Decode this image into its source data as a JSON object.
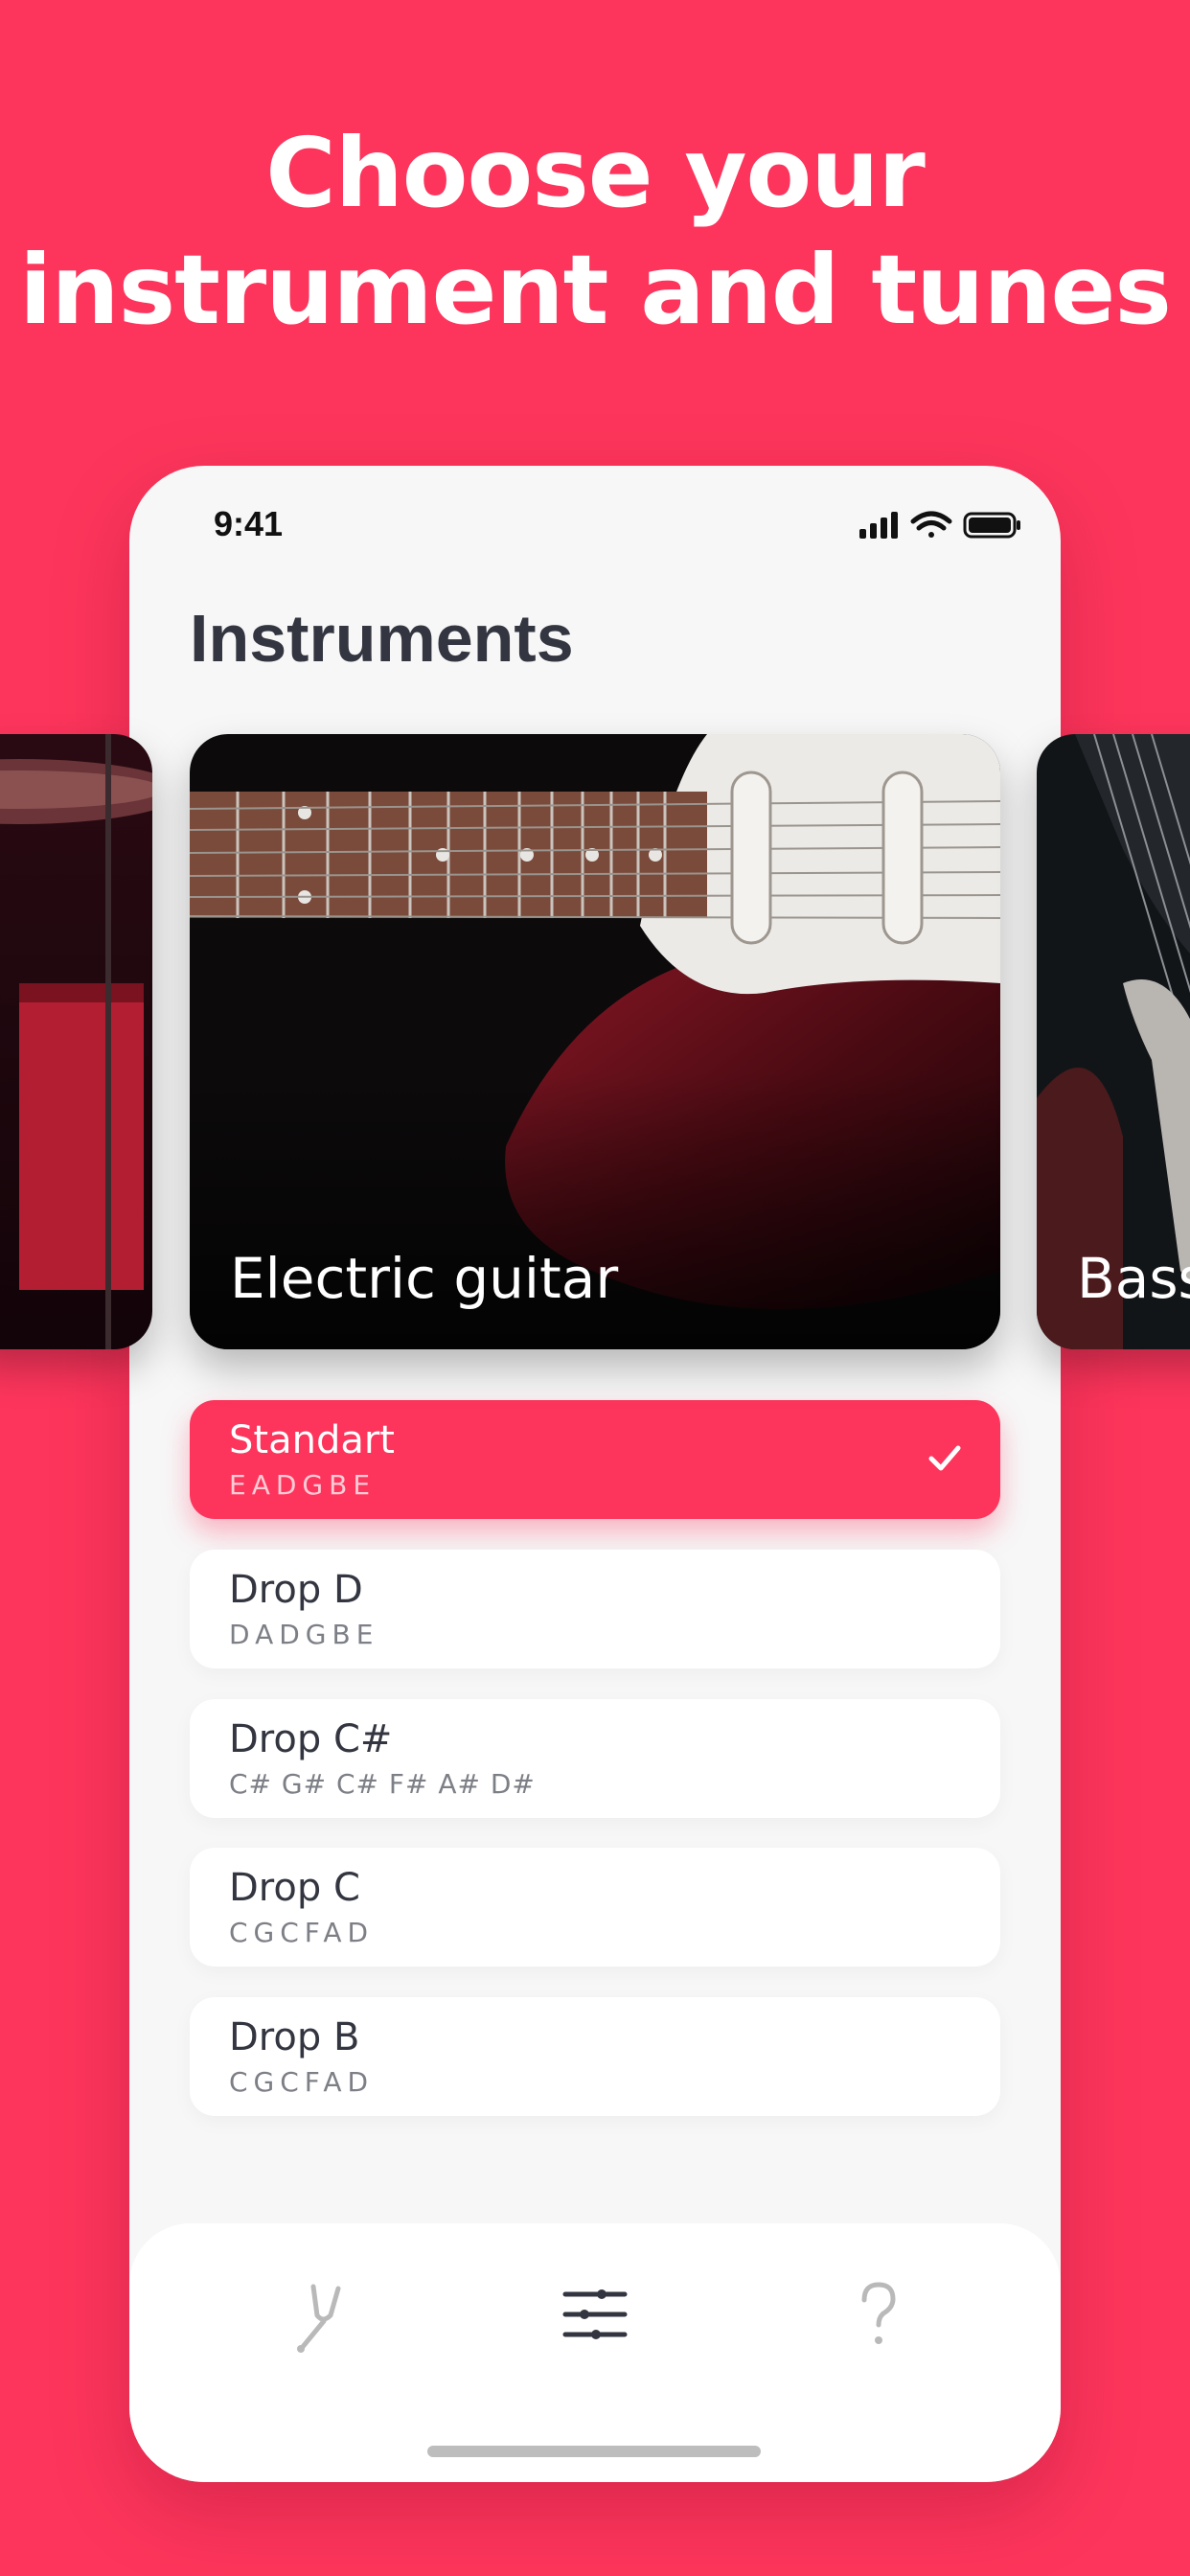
{
  "headline": {
    "line1": "Choose your",
    "line2": "instrument and tunes"
  },
  "status_bar": {
    "time": "9:41"
  },
  "screen": {
    "title": "Instruments"
  },
  "instruments": [
    {
      "label": "",
      "image": "drum-kit-photo"
    },
    {
      "label": "Electric guitar",
      "image": "electric-guitar-photo"
    },
    {
      "label": "Bass",
      "image": "bass-guitar-photo"
    }
  ],
  "tunings": [
    {
      "name": "Standart",
      "notes": "EADGBE",
      "selected": true
    },
    {
      "name": "Drop D",
      "notes": "DADGBE",
      "selected": false
    },
    {
      "name": "Drop C#",
      "notes": "C# G# C# F# A# D#",
      "selected": false
    },
    {
      "name": "Drop C",
      "notes": "CGCFAD",
      "selected": false
    },
    {
      "name": "Drop B",
      "notes": "CGCFAD",
      "selected": false
    }
  ],
  "tabbar": {
    "items": [
      "tuning-fork-icon",
      "sliders-icon",
      "help-icon"
    ],
    "active": "sliders-icon"
  },
  "colors": {
    "accent": "#fd355c",
    "text_dark": "#333640",
    "text_muted": "#7d7f86",
    "screen_bg": "#f7f7f7"
  }
}
